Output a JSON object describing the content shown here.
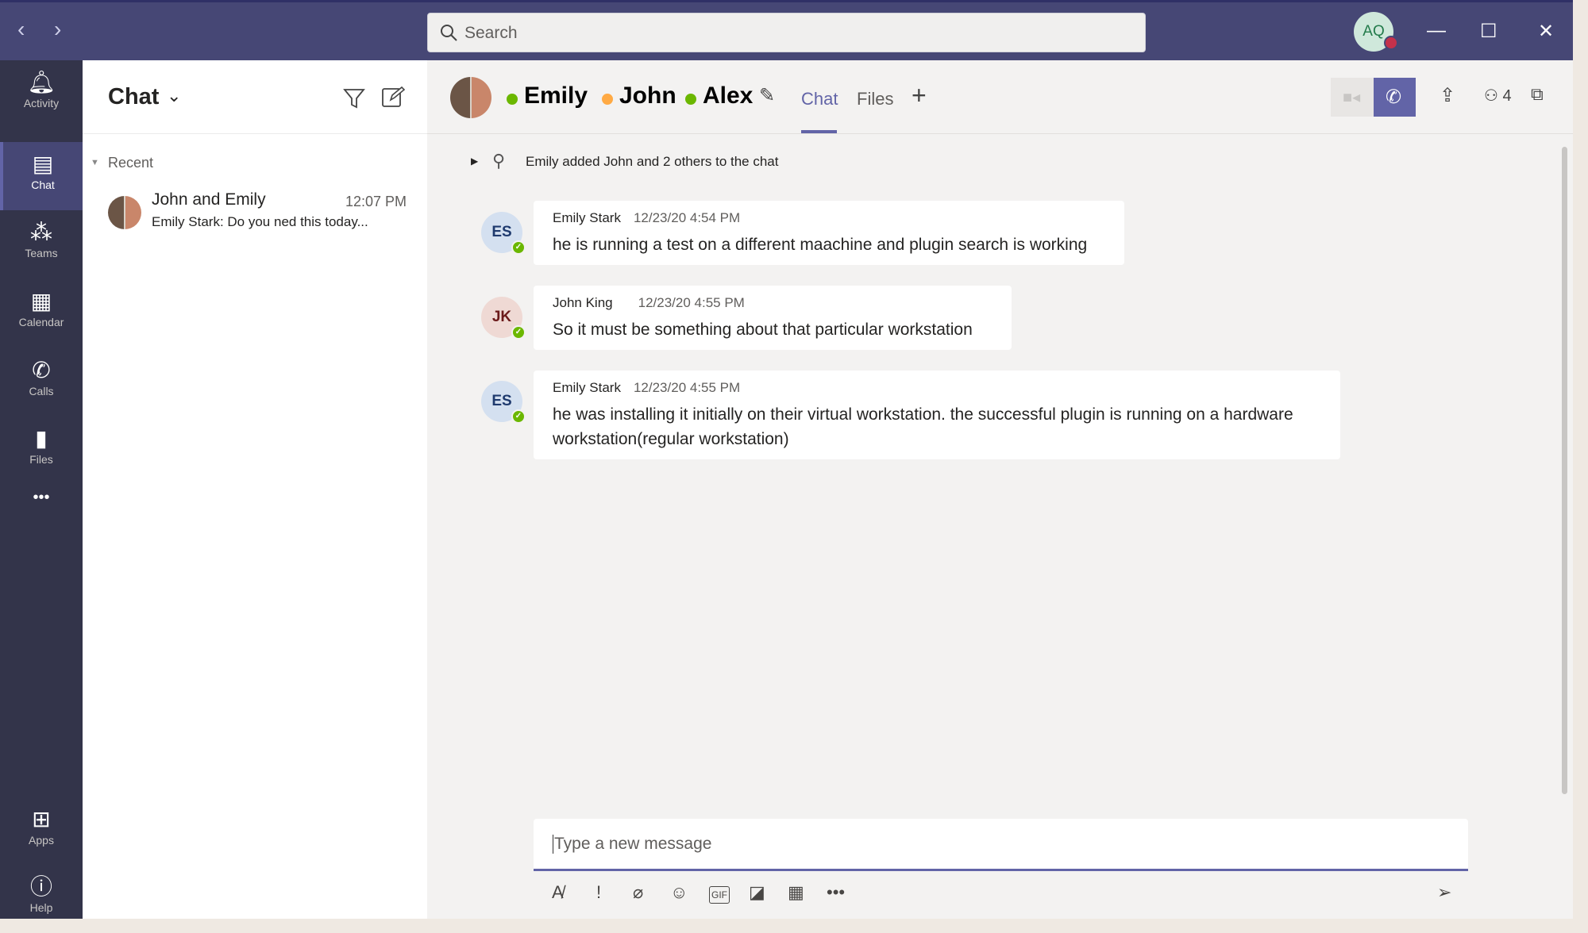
{
  "titlebar": {
    "back": "‹",
    "forward": "›",
    "search_placeholder": "Search",
    "user_initials": "AQ",
    "minimize": "—",
    "maximize": "☐",
    "close": "✕"
  },
  "rail": {
    "items": [
      {
        "label": "Activity",
        "icon": "bell-icon"
      },
      {
        "label": "Chat",
        "icon": "chat-icon"
      },
      {
        "label": "Teams",
        "icon": "teams-icon"
      },
      {
        "label": "Calendar",
        "icon": "calendar-icon"
      },
      {
        "label": "Calls",
        "icon": "phone-icon"
      },
      {
        "label": "Files",
        "icon": "file-icon"
      }
    ],
    "more": "•••",
    "apps": "Apps",
    "help": "Help"
  },
  "chat_list": {
    "title": "Chat",
    "section": "Recent",
    "items": [
      {
        "name": "John and Emily",
        "time": "12:07 PM",
        "preview": "Emily Stark: Do you ned this today..."
      }
    ]
  },
  "conversation": {
    "participants": [
      {
        "name": "Emily",
        "status": "available",
        "color": "#6bb700"
      },
      {
        "name": "John",
        "status": "away",
        "color": "#ffaa44"
      },
      {
        "name": "Alex",
        "status": "available",
        "color": "#6bb700"
      }
    ],
    "tabs": [
      "Chat",
      "Files"
    ],
    "active_tab": "Chat",
    "people_count": "4",
    "system_message": "Emily added John and 2 others to the chat",
    "messages": [
      {
        "initials": "ES",
        "author": "Emily Stark",
        "time": "12/23/20 4:54 PM",
        "text": "he is running a test on a different maachine and plugin search is working"
      },
      {
        "initials": "JK",
        "author": "John King",
        "time": "12/23/20 4:55 PM",
        "text": "So it must be something about that particular workstation"
      },
      {
        "initials": "ES",
        "author": "Emily Stark",
        "time": "12/23/20 4:55 PM",
        "text": "he was installing it initially on their virtual workstation. the successful plugin is running on a hardware workstation(regular workstation)"
      }
    ],
    "compose_placeholder": "Type a new message"
  },
  "colors": {
    "titlebar": "#464775",
    "rail": "#33344a",
    "accent": "#6264a7"
  }
}
